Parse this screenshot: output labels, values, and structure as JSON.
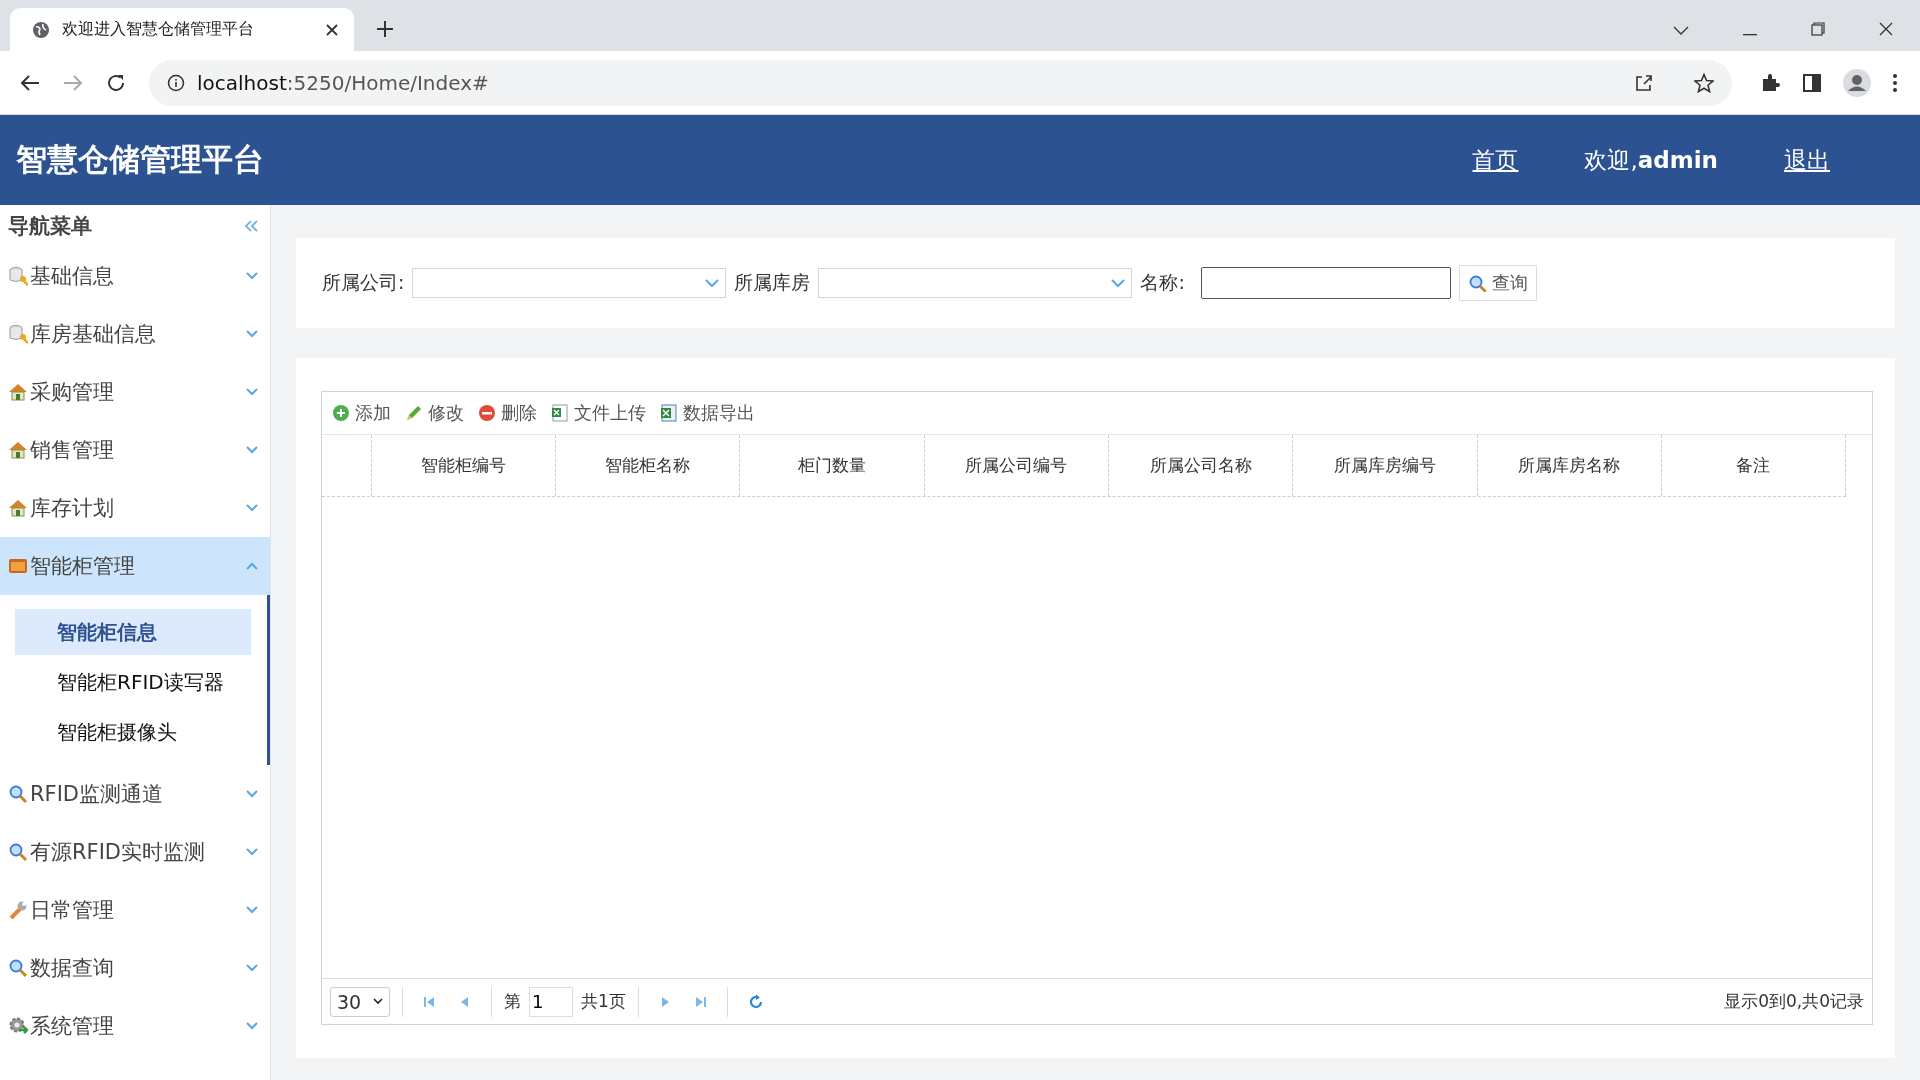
{
  "browser": {
    "tab_title": "欢迎进入智慧仓储管理平台",
    "url_host": "localhost",
    "url_rest": ":5250/Home/Index#"
  },
  "header": {
    "title": "智慧仓储管理平台",
    "links": [
      {
        "text": "首页",
        "kind": "link"
      },
      {
        "text": "欢迎,**admin**",
        "kind": "text"
      },
      {
        "text": "退出",
        "kind": "link"
      }
    ]
  },
  "sidebar": {
    "title": "导航菜单",
    "items": [
      {
        "label": "基础信息",
        "kind": "db",
        "expanded": false
      },
      {
        "label": "库房基础信息",
        "kind": "db",
        "expanded": false
      },
      {
        "label": "采购管理",
        "kind": "house",
        "expanded": false
      },
      {
        "label": "销售管理",
        "kind": "house",
        "expanded": false
      },
      {
        "label": "库存计划",
        "kind": "house",
        "expanded": false
      },
      {
        "label": "智能柜管理",
        "kind": "cabinet",
        "expanded": true,
        "children": [
          {
            "label": "智能柜信息",
            "selected": true
          },
          {
            "label": "智能柜RFID读写器",
            "selected": false
          },
          {
            "label": "智能柜摄像头",
            "selected": false
          }
        ]
      },
      {
        "label": "RFID监测通道",
        "kind": "search",
        "expanded": false
      },
      {
        "label": "有源RFID实时监测",
        "kind": "search",
        "expanded": false
      },
      {
        "label": "日常管理",
        "kind": "wrench",
        "expanded": false
      },
      {
        "label": "数据查询",
        "kind": "search",
        "expanded": false
      },
      {
        "label": "系统管理",
        "kind": "gear",
        "expanded": false
      }
    ]
  },
  "search": {
    "fields": [
      {
        "label": "所属公司:",
        "kind": "select"
      },
      {
        "label": "所属库房",
        "kind": "select"
      },
      {
        "label": "名称:",
        "kind": "text"
      }
    ],
    "button": "查询"
  },
  "toolbar": [
    {
      "label": "添加",
      "kind": "add"
    },
    {
      "label": "修改",
      "kind": "edit"
    },
    {
      "label": "删除",
      "kind": "delete"
    },
    {
      "label": "文件上传",
      "kind": "upload"
    },
    {
      "label": "数据导出",
      "kind": "export"
    }
  ],
  "table": {
    "columns": [
      "智能柜编号",
      "智能柜名称",
      "柜门数量",
      "所属公司编号",
      "所属公司名称",
      "所属库房编号",
      "所属库房名称",
      "备注"
    ]
  },
  "pager": {
    "page_size": "30",
    "page_prefix": "第",
    "page_value": "1",
    "page_total": "共1页",
    "info": "显示0到0,共0记录"
  }
}
